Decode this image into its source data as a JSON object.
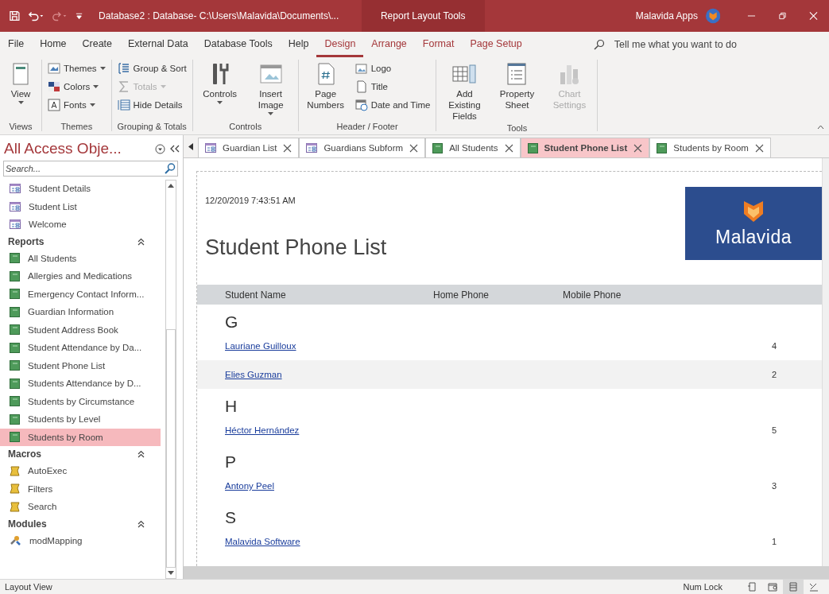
{
  "title_bar": {
    "title": "Database2 : Database- C:\\Users\\Malavida\\Documents\\...",
    "context_label": "Report Layout Tools",
    "account": "Malavida Apps"
  },
  "ribbon_tabs": [
    {
      "label": "File",
      "kind": "main",
      "selected": false
    },
    {
      "label": "Home",
      "kind": "main",
      "selected": false
    },
    {
      "label": "Create",
      "kind": "main",
      "selected": false
    },
    {
      "label": "External Data",
      "kind": "main",
      "selected": false
    },
    {
      "label": "Database Tools",
      "kind": "main",
      "selected": false
    },
    {
      "label": "Help",
      "kind": "main",
      "selected": false
    },
    {
      "label": "Design",
      "kind": "contextual",
      "selected": true
    },
    {
      "label": "Arrange",
      "kind": "contextual",
      "selected": false
    },
    {
      "label": "Format",
      "kind": "contextual",
      "selected": false
    },
    {
      "label": "Page Setup",
      "kind": "contextual",
      "selected": false
    }
  ],
  "tell_me": {
    "placeholder": "Tell me what you want to do"
  },
  "ribbon_groups": [
    {
      "label": "Views",
      "commands": [
        {
          "label": "View",
          "kind": "large",
          "dropdown": true,
          "disabled": false
        }
      ]
    },
    {
      "label": "Themes",
      "commands": [
        {
          "label": "Themes",
          "kind": "small",
          "dropdown": true,
          "disabled": false
        },
        {
          "label": "Colors",
          "kind": "small",
          "dropdown": true,
          "disabled": false
        },
        {
          "label": "Fonts",
          "kind": "small",
          "dropdown": true,
          "disabled": false
        }
      ]
    },
    {
      "label": "Grouping & Totals",
      "commands": [
        {
          "label": "Group & Sort",
          "kind": "small",
          "dropdown": false,
          "disabled": false
        },
        {
          "label": "Totals",
          "kind": "small",
          "dropdown": true,
          "disabled": true
        },
        {
          "label": "Hide Details",
          "kind": "small",
          "dropdown": false,
          "disabled": false
        }
      ]
    },
    {
      "label": "Controls",
      "commands": [
        {
          "label": "Controls",
          "kind": "large",
          "dropdown": true,
          "disabled": false
        },
        {
          "label": "Insert Image",
          "kind": "large",
          "dropdown": true,
          "disabled": false
        }
      ]
    },
    {
      "label": "Header / Footer",
      "commands": [
        {
          "label": "Page Numbers",
          "kind": "large",
          "dropdown": false,
          "disabled": false
        },
        {
          "label": "Logo",
          "kind": "small",
          "dropdown": false,
          "disabled": false
        },
        {
          "label": "Title",
          "kind": "small",
          "dropdown": false,
          "disabled": false
        },
        {
          "label": "Date and Time",
          "kind": "small",
          "dropdown": false,
          "disabled": false
        }
      ]
    },
    {
      "label": "Tools",
      "commands": [
        {
          "label": "Add Existing Fields",
          "kind": "large",
          "dropdown": false,
          "disabled": false
        },
        {
          "label": "Property Sheet",
          "kind": "large",
          "dropdown": false,
          "disabled": false
        },
        {
          "label": "Chart Settings",
          "kind": "large",
          "dropdown": false,
          "disabled": true
        }
      ]
    }
  ],
  "nav_pane": {
    "title": "All Access Obje...",
    "search": {
      "placeholder": "Search..."
    },
    "groups": [
      {
        "items": [
          {
            "label": "Student Details",
            "kind": "form",
            "selected": false
          },
          {
            "label": "Student List",
            "kind": "form",
            "selected": false
          },
          {
            "label": "Welcome",
            "kind": "form",
            "selected": false
          }
        ]
      },
      {
        "heading": "Reports",
        "expanded": true,
        "items": [
          {
            "label": "All Students",
            "kind": "report",
            "selected": false
          },
          {
            "label": "Allergies and Medications",
            "kind": "report",
            "selected": false
          },
          {
            "label": "Emergency Contact Inform...",
            "kind": "report",
            "selected": false
          },
          {
            "label": "Guardian Information",
            "kind": "report",
            "selected": false
          },
          {
            "label": "Student Address Book",
            "kind": "report",
            "selected": false
          },
          {
            "label": "Student Attendance by Da...",
            "kind": "report",
            "selected": false
          },
          {
            "label": "Student Phone List",
            "kind": "report",
            "selected": false
          },
          {
            "label": "Students Attendance by D...",
            "kind": "report",
            "selected": false
          },
          {
            "label": "Students by Circumstance",
            "kind": "report",
            "selected": false
          },
          {
            "label": "Students by Level",
            "kind": "report",
            "selected": false
          },
          {
            "label": "Students by Room",
            "kind": "report",
            "selected": true
          }
        ]
      },
      {
        "heading": "Macros",
        "expanded": true,
        "items": [
          {
            "label": "AutoExec",
            "kind": "macro",
            "selected": false
          },
          {
            "label": "Filters",
            "kind": "macro",
            "selected": false
          },
          {
            "label": "Search",
            "kind": "macro",
            "selected": false
          }
        ]
      },
      {
        "heading": "Modules",
        "expanded": true,
        "items": [
          {
            "label": "modMapping",
            "kind": "module",
            "selected": false
          }
        ]
      }
    ]
  },
  "document_tabs": [
    {
      "label": "Guardian List",
      "kind": "form",
      "selected": false
    },
    {
      "label": "Guardians Subform",
      "kind": "form",
      "selected": false
    },
    {
      "label": "All Students",
      "kind": "report",
      "selected": false
    },
    {
      "label": "Student Phone List",
      "kind": "report",
      "selected": true
    },
    {
      "label": "Students by Room",
      "kind": "report",
      "selected": false
    }
  ],
  "report": {
    "date": "12/20/2019 7:43:51 AM",
    "title": "Student Phone List",
    "logo_text": "Malavida",
    "columns": [
      "Student Name",
      "Home Phone",
      "Mobile Phone"
    ],
    "groups": [
      {
        "letter": "G",
        "rows": [
          {
            "name": "Lauriane Guilloux",
            "value": "4"
          },
          {
            "name": "Elies Guzman",
            "value": "2"
          }
        ]
      },
      {
        "letter": "H",
        "rows": [
          {
            "name": "Héctor Hernández",
            "value": "5"
          }
        ]
      },
      {
        "letter": "P",
        "rows": [
          {
            "name": "Antony Peel",
            "value": "3"
          }
        ]
      },
      {
        "letter": "S",
        "rows": [
          {
            "name": "Malavida Software",
            "value": "1"
          }
        ]
      }
    ]
  },
  "status_bar": {
    "text": "Layout View",
    "indicator": "Num Lock",
    "view_buttons": [
      {
        "selected": false
      },
      {
        "selected": false
      },
      {
        "selected": true
      },
      {
        "selected": false
      }
    ]
  }
}
